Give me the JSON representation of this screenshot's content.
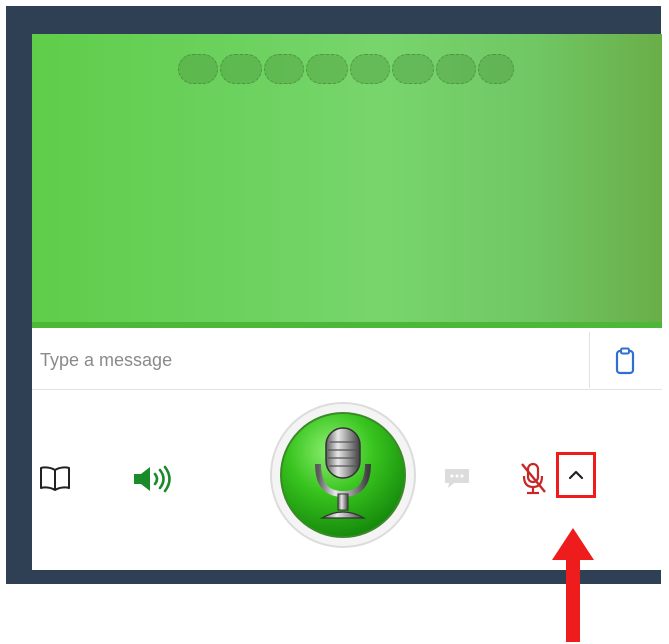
{
  "message": {
    "placeholder": "Type a message"
  },
  "colors": {
    "frame": "#2f4055",
    "panel_green": "#6dd260",
    "mic_green": "#38c41e",
    "speaker_green": "#1b8a2a",
    "mute_red": "#c62828",
    "highlight_red": "#ee1c1c"
  },
  "icons": {
    "clipboard": "clipboard-icon",
    "book": "book-icon",
    "speaker": "speaker-icon",
    "microphone": "microphone-icon",
    "chat": "chat-bubble-icon",
    "mic_off": "mic-off-icon",
    "expand": "chevron-up-icon",
    "annotation": "arrow-up-icon"
  },
  "status_dots": 8
}
